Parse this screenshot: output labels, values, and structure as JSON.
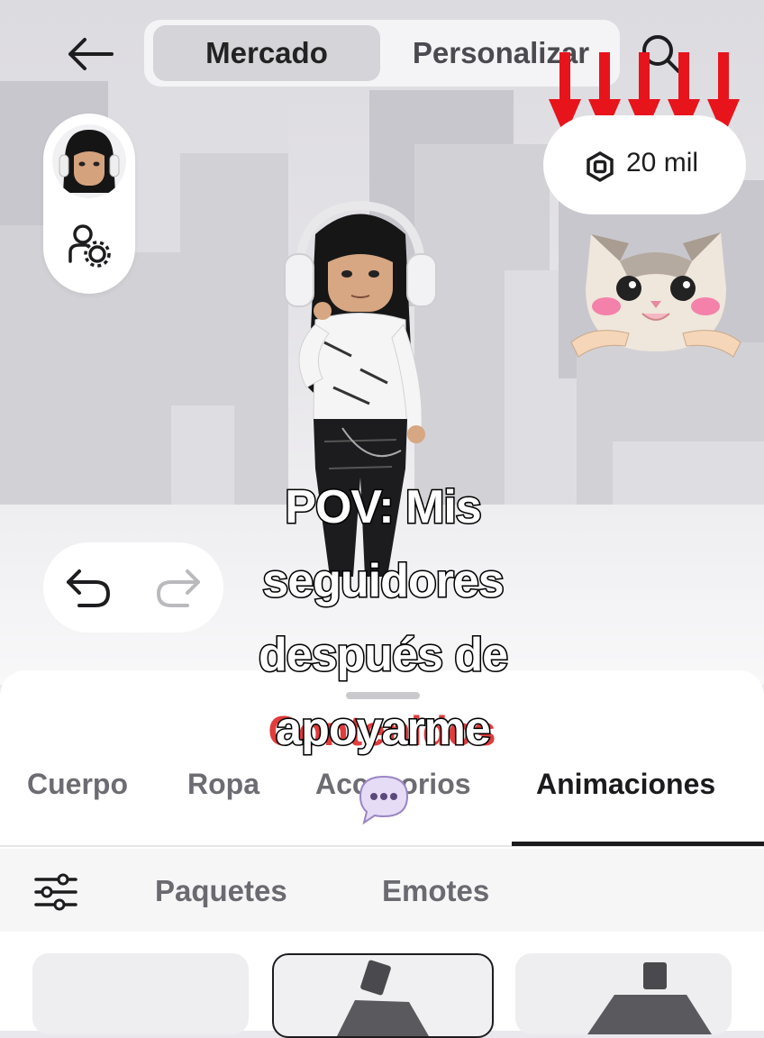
{
  "header": {
    "tabs": [
      "Mercado",
      "Personalizar"
    ],
    "active_tab": "Mercado"
  },
  "currency": {
    "amount": "20 mil",
    "icon": "robux-icon"
  },
  "caption": {
    "lines": [
      "POV: Mis",
      "seguidores",
      "después de",
      "apoyarme"
    ]
  },
  "sheet": {
    "title": "Contenidos",
    "categories": [
      "Cuerpo",
      "Ropa",
      "Accesorios",
      "Animaciones"
    ],
    "active_category": "Animaciones",
    "subtabs": [
      "Paquetes",
      "Emotes"
    ]
  },
  "colors": {
    "arrow": "#e8141c",
    "title_red": "#e23c3c",
    "robux_dark": "#1d1d1f"
  }
}
